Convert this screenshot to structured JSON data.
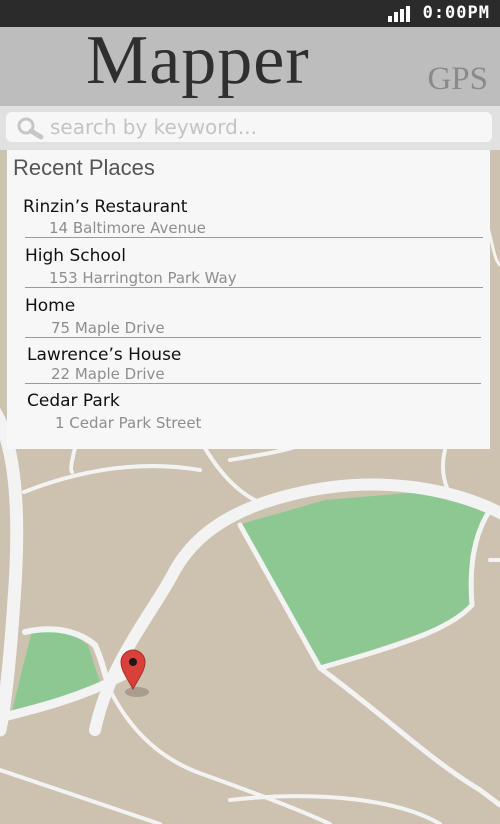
{
  "status_bar": {
    "time": "0:00PM",
    "signal_icon": "signal-bars-icon"
  },
  "header": {
    "title": "Mapper",
    "subtitle": "GPS"
  },
  "search": {
    "placeholder": "search by keyword...",
    "value": "",
    "icon": "search-icon"
  },
  "recent_places": {
    "title": "Recent Places",
    "items": [
      {
        "name": "Rinzin’s Restaurant",
        "address": "14 Baltimore Avenue"
      },
      {
        "name": "High School",
        "address": "153 Harrington Park Way"
      },
      {
        "name": "Home",
        "address": "75 Maple Drive"
      },
      {
        "name": "Lawrence’s House",
        "address": "22 Maple Drive"
      },
      {
        "name": "Cedar Park",
        "address": "1 Cedar Park Street"
      }
    ]
  },
  "map": {
    "marker_icon": "map-pin-icon",
    "colors": {
      "land": "#cdc1b0",
      "park": "#8dc893",
      "road": "#f3f3f3",
      "marker": "#d9403a"
    }
  }
}
